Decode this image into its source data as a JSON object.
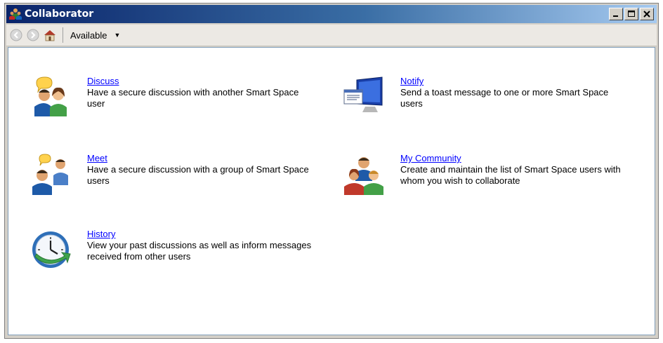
{
  "window": {
    "title": "Collaborator"
  },
  "toolbar": {
    "status_label": "Available"
  },
  "items": [
    {
      "label": "Discuss",
      "description": "Have a secure discussion with another Smart Space user"
    },
    {
      "label": "Notify",
      "description": "Send a toast message to one or more Smart Space users"
    },
    {
      "label": "Meet",
      "description": "Have a secure discussion with a group of Smart Space users"
    },
    {
      "label": "My Community",
      "description": "Create and maintain the list of Smart Space users with whom you wish to collaborate"
    },
    {
      "label": "History",
      "description": "View your past discussions as well as inform messages received from other users"
    }
  ]
}
